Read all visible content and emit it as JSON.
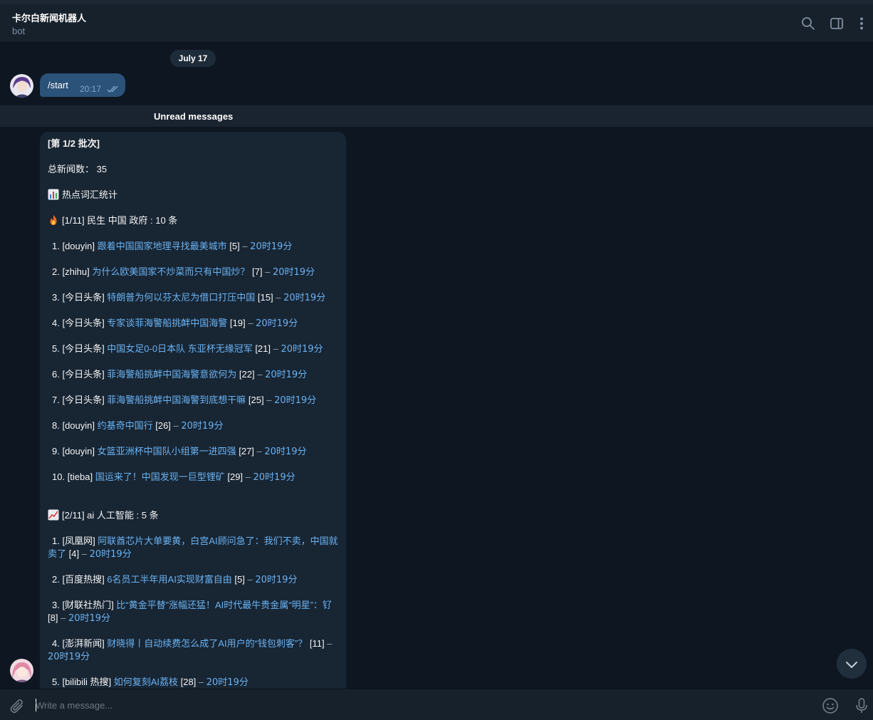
{
  "header": {
    "title": "卡尔白新闻机器人",
    "subtitle": "bot"
  },
  "date_divider": "July 17",
  "outgoing": {
    "text": "/start",
    "time": "20:17"
  },
  "unread_label": "Unread messages",
  "news": {
    "batch": "[第 1/2 批次]",
    "total": "总新闻数：  35",
    "stats_title": "热点词汇统计",
    "groups": [
      {
        "header": "[1/11] 民生 中国 政府 : 10 条",
        "items": [
          {
            "num": "1. [douyin] ",
            "title": "跟着中国国家地理寻找最美城市",
            "rank": " [5]",
            "time": "20时19分"
          },
          {
            "num": "2. [zhihu] ",
            "title": "为什么欧美国家不炒菜而只有中国炒？",
            "rank": " [7]",
            "time": "20时19分"
          },
          {
            "num": "3. [今日头条] ",
            "title": "特朗普为何以芬太尼为借口打压中国",
            "rank": " [15]",
            "time": "20时19分"
          },
          {
            "num": "4. [今日头条] ",
            "title": "专家谈菲海警船挑衅中国海警",
            "rank": " [19]",
            "time": "20时19分"
          },
          {
            "num": "5. [今日头条] ",
            "title": "中国女足0-0日本队 东亚杯无缘冠军",
            "rank": " [21]",
            "time": "20时19分"
          },
          {
            "num": "6. [今日头条] ",
            "title": "菲海警船挑衅中国海警意欲何为",
            "rank": " [22]",
            "time": "20时19分"
          },
          {
            "num": "7. [今日头条] ",
            "title": "菲海警船挑衅中国海警到底想干嘛",
            "rank": " [25]",
            "time": "20时19分"
          },
          {
            "num": "8. [douyin] ",
            "title": "约基奇中国行",
            "rank": " [26]",
            "time": "20时19分"
          },
          {
            "num": "9. [douyin] ",
            "title": "女篮亚洲杯中国队小组第一进四强",
            "rank": " [27]",
            "time": "20时19分"
          },
          {
            "num": "10. [tieba] ",
            "title": "国运来了！中国发现一巨型锂矿",
            "rank": " [29]",
            "time": "20时19分"
          }
        ]
      },
      {
        "header": "[2/11] ai 人工智能 : 5 条",
        "items": [
          {
            "num": "1. [凤凰网] ",
            "title": "阿联酋芯片大单要黄，白宫AI顾问急了：我们不卖，中国就卖了",
            "rank": " [4]",
            "time": "20时19分"
          },
          {
            "num": "2. [百度热搜] ",
            "title": "6名员工半年用AI实现财富自由",
            "rank": " [5]",
            "time": "20时19分"
          },
          {
            "num": "3. [财联社热门] ",
            "title": "比“黄金平替”涨幅还猛！AI时代最牛贵金属“明星”：钌",
            "rank": " [8]",
            "time": "20时19分"
          },
          {
            "num": "4. [澎湃新闻] ",
            "title": "财晓得丨自动续费怎么成了AI用户的“钱包刺客”？",
            "rank": " [11]",
            "time": "20时19分"
          },
          {
            "num": "5. [bilibili 热搜] ",
            "title": "如何复刻AI荔枝",
            "rank": " [28]",
            "time": "20时19分"
          }
        ]
      }
    ]
  },
  "composer": {
    "placeholder": "Write a message..."
  },
  "icons": [
    "search-icon",
    "sidebar-toggle-icon",
    "more-vertical-icon",
    "double-check-icon",
    "chart-emoji-icon",
    "fire-emoji-icon",
    "trend-emoji-icon",
    "chevron-down-icon",
    "paperclip-icon",
    "emoji-icon",
    "microphone-icon"
  ],
  "colors": {
    "background": "#0e1621",
    "header": "#17212b",
    "outgoing_bubble": "#2b5278",
    "incoming_bubble": "#182533",
    "link": "#6ab3f3"
  }
}
